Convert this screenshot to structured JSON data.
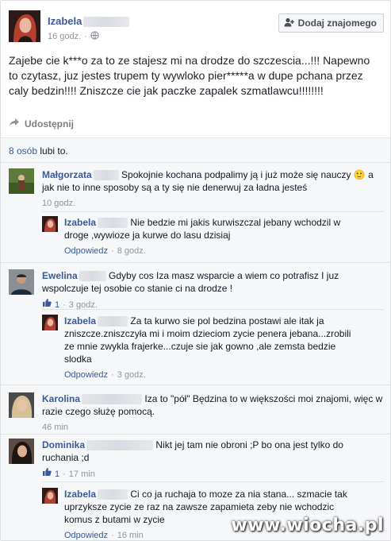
{
  "post": {
    "author": "Izabela",
    "time": "16 godz.",
    "add_friend_label": "Dodaj znajomego",
    "text": "Zajebe cie k***o za to ze stajesz mi na drodze do szczescia...!!! Napewno to czytasz, juz jestes trupem ty wywloko pier*****a w dupe pchana przez caly bedzin!!!! Zniszcze cie jak paczke zapalek szmatlawcu!!!!!!!!",
    "share_label": "Udostępnij"
  },
  "likes": {
    "count_link": "8 osób",
    "suffix": " lubi to."
  },
  "comments": [
    {
      "name": "Małgorzata",
      "text": "Spokojnie kochana podpalimy ją i już może się nauczy 🙂 a jak nie to inne sposoby są a ty się nie denerwuj za ładna jesteś",
      "time": "10 godz.",
      "replies": [
        {
          "name": "Izabela",
          "text": "Nie bedzie mi jakis kurwiszczal jebany wchodzil w droge ,wywioze ja kurwe do lasu dzisiaj",
          "reply_label": "Odpowiedz",
          "time": "8 godz."
        }
      ]
    },
    {
      "name": "Ewelina",
      "text": "Gdyby cos Iza masz wsparcie a wiem co potrafisz I juz wspolczuje tej osobie co stanie ci na drodze !",
      "likes": "1",
      "time": "3 godz.",
      "replies": [
        {
          "name": "Izabela",
          "text": "Za ta kurwo sie pol bedzina postawi ale itak ja zniszcze.zniszczyła mi i moim dzieciom zycie penera jebana...zrobili ze mnie zwykla frajerke...czuje sie jak gowno ,ale zemsta bedzie slodka",
          "reply_label": "Odpowiedz",
          "time": "3 godz."
        }
      ]
    },
    {
      "name": "Karolina",
      "text": "Iza to \"pół\" Będzina to w większości moi znajomi, więc w razie czego służę pomocą.",
      "time": "46 min"
    },
    {
      "name": "Dominika",
      "text": "Nikt jej tam nie obroni ;P bo ona jest tylko do ruchania ;d",
      "likes": "1",
      "time": "17 min",
      "replies": [
        {
          "name": "Izabela",
          "text": "Ci co ja ruchaja to moze za nia stana... szmacie tak uprzyksze zycie ze raz na zawsze zapamieta zeby nie wchodzic komus z butami w zycie",
          "reply_label": "Odpowiedz",
          "time": "16 min"
        }
      ]
    }
  ],
  "watermark": "www.wiocha.pl",
  "colors": {
    "link": "#3b5998",
    "meta": "#90949c",
    "bg": "#f6f7f9"
  }
}
